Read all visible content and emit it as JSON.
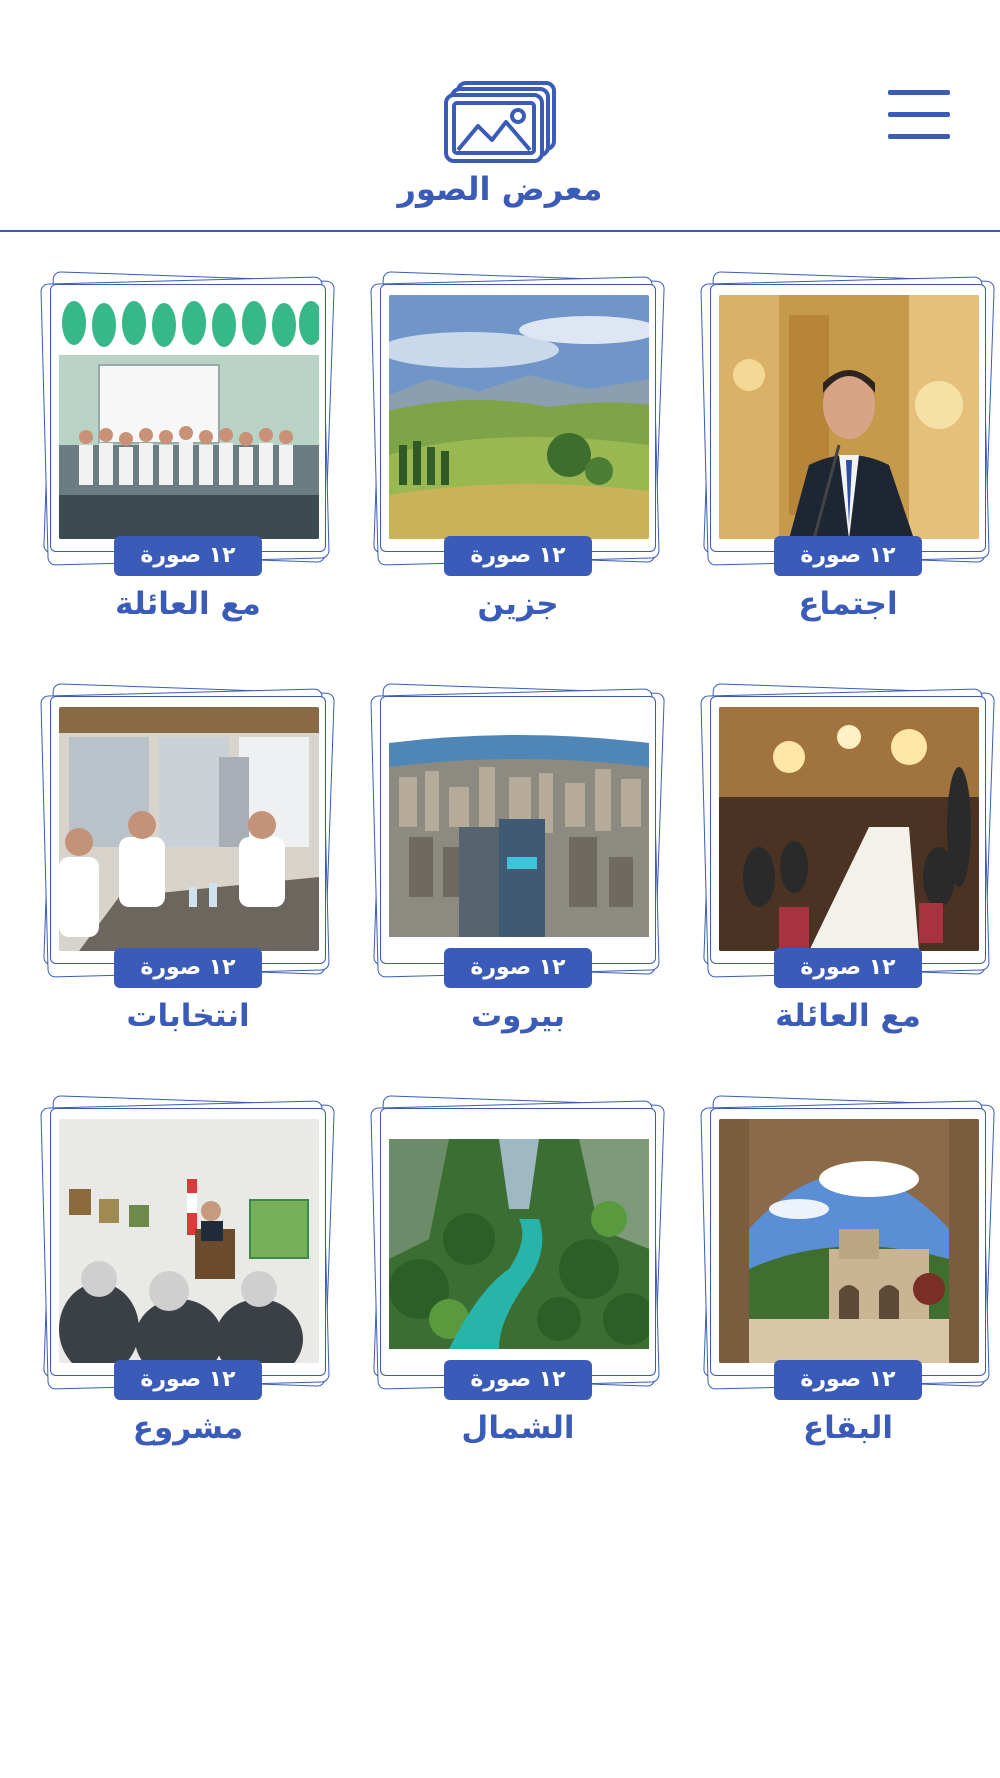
{
  "header": {
    "title": "معرض الصور",
    "logo_icon": "photo-gallery-icon",
    "menu_icon": "hamburger-menu-icon"
  },
  "colors": {
    "accent": "#3a5cb8",
    "background": "#ffffff",
    "badge_text": "#ffffff"
  },
  "albums": [
    {
      "title": "اجتماع",
      "count": "١٢ صورة",
      "photo": "man-speaking-at-podium"
    },
    {
      "title": "جزين",
      "count": "١٢ صورة",
      "photo": "green-valley-landscape"
    },
    {
      "title": "مع العائلة",
      "count": "١٢ صورة",
      "photo": "group-photo-with-balloons"
    },
    {
      "title": "مع العائلة",
      "count": "١٢ صورة",
      "photo": "banquet-hall-dinner"
    },
    {
      "title": "بيروت",
      "count": "١٢ صورة",
      "photo": "beirut-aerial-city"
    },
    {
      "title": "انتخابات",
      "count": "١٢ صورة",
      "photo": "office-meeting-table"
    },
    {
      "title": "البقاع",
      "count": "١٢ صورة",
      "photo": "stone-arch-village"
    },
    {
      "title": "الشمال",
      "count": "١٢ صورة",
      "photo": "river-valley-gorge"
    },
    {
      "title": "مشروع",
      "count": "١٢ صورة",
      "photo": "speech-in-art-gallery"
    }
  ]
}
